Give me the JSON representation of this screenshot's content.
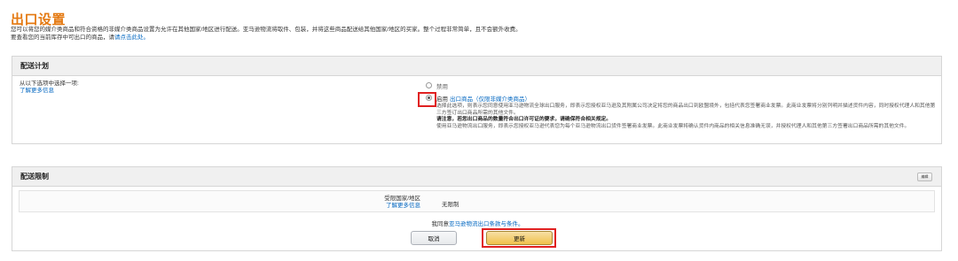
{
  "page": {
    "title": "出口设置",
    "intro_line1": "您可以将您的媒介类商品和符合资格的非媒介类商品设置为允许在其他国家/地区进行配送。亚马逊物流将取件、包装，并将这些商品配送给其他国家/地区的买家。整个过程非常简单，且不会额外收费。",
    "intro_line2_prefix": "要查看您的当前库存中可出口的商品，请",
    "intro_line2_link": "请点击此处。"
  },
  "plan": {
    "header": "配送计划",
    "left_label": "从以下选项中选择一项:",
    "learn_more": "了解更多信息",
    "option_disabled": "禁用",
    "option_enabled_prefix": "启用",
    "option_enabled_link": "出口商品（仅限非媒介类商品）",
    "desc1": "选择此选项，则表示您同意使用亚马逊物流全球出口服务，即表示您授权亚马逊及其附属公司决定将您的商品出口到欧盟境外，包括代表您签署商业发票。此商业发票将分别列明并描述货件内容，同时授权代理人和其他第三方签订出口商品所需的其他文件。",
    "desc2": "请注意，若您出口商品的数量符合出口许可证的要求，请确保符合相关规定。",
    "desc3": "使用亚马逊物流出口服务，即表示您授权亚马逊代表您为每个亚马逊物流出口货件签署商业发票。此商业发票将确认货件内商品的相关信息准确无误，并授权代理人和其他第三方签署出口商品所需的其他文件。"
  },
  "limit": {
    "header": "配送限制",
    "edit_label": "编辑",
    "field_label": "受限国家/地区",
    "learn_more": "了解更多信息",
    "field_value": "无限制",
    "agree_prefix": "我同意",
    "agree_link": "亚马逊物流出口条款与条件。",
    "cancel": "取消",
    "update": "更新"
  }
}
